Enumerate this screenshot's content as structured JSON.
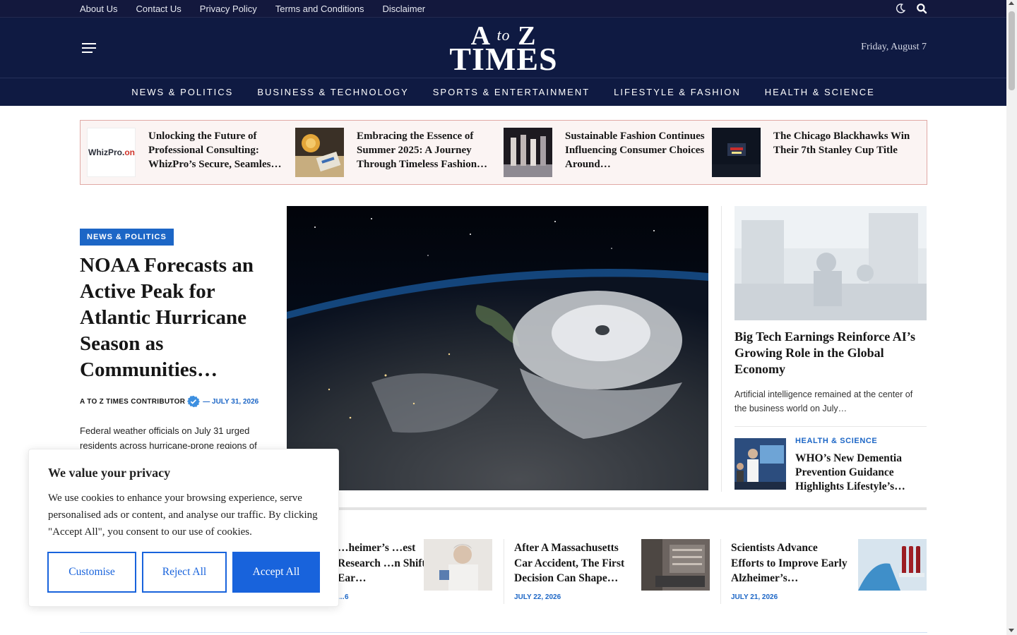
{
  "topbar": {
    "links": [
      "About Us",
      "Contact Us",
      "Privacy Policy",
      "Terms and Conditions",
      "Disclaimer"
    ],
    "icons": [
      "moon-icon",
      "search-icon"
    ]
  },
  "header": {
    "logo_line1_a": "A",
    "logo_line1_to": "to",
    "logo_line1_z": "Z",
    "logo_line2": "TIMES",
    "date": "Friday, August 7"
  },
  "nav": {
    "items": [
      "NEWS & POLITICS",
      "BUSINESS & TECHNOLOGY",
      "SPORTS & ENTERTAINMENT",
      "LIFESTYLE & FASHION",
      "HEALTH & SCIENCE"
    ]
  },
  "ticker": {
    "whiz_logo": "WhizPro.",
    "whiz_logo_suffix": "onl",
    "items": [
      {
        "title": "Unlocking the Future of Professional Consulting: WhizPro’s Secure, Seamles…"
      },
      {
        "title": "Embracing the Essence of Summer 2025: A Journey Through Timeless Fashion…"
      },
      {
        "title": "Sustainable Fashion Continues Influencing Consumer Choices Around…"
      },
      {
        "title": "The Chicago Blackhawks Win Their 7th Stanley Cup Title"
      }
    ]
  },
  "main": {
    "category": "NEWS & POLITICS",
    "title": "NOAA Forecasts an Active Peak for Atlantic Hurricane Season as Communities…",
    "author": "A TO Z TIMES CONTRIBUTOR",
    "date": "— JULY 31, 2026",
    "excerpt": "Federal weather officials on July 31 urged residents across hurricane-prone regions of"
  },
  "right": {
    "title": "Big Tech Earnings Reinforce AI’s Growing Role in the Global Economy",
    "excerpt": "Artificial intelligence remained at the center of the business world on July…",
    "small_category": "HEALTH & SCIENCE",
    "small_title": "WHO’s New Dementia Prevention Guidance Highlights Lifestyle’s…"
  },
  "bottom": {
    "cards": [
      {
        "title": "…heimer’s …est Research …n Shift in Ear…",
        "date": "…6"
      },
      {
        "title": "After A Massachusetts Car Accident, The First Decision Can Shape…",
        "date": "JULY 22, 2026"
      },
      {
        "title": "Scientists Advance Efforts to Improve Early Alzheimer’s…",
        "date": "JULY 21, 2026"
      }
    ]
  },
  "cookie": {
    "title": "We value your privacy",
    "body": "We use cookies to enhance your browsing experience, serve personalised ads or content, and analyse our traffic. By clicking \"Accept All\", you consent to our use of cookies.",
    "customise": "Customise",
    "reject": "Reject All",
    "accept": "Accept All"
  },
  "colors": {
    "navy": "#0f1a42",
    "topbar": "#13183d",
    "accent_blue": "#1c66c6",
    "cookie_blue": "#1863dc",
    "ticker_bg": "#fbf4f3",
    "ticker_border": "#e0a9a5"
  }
}
